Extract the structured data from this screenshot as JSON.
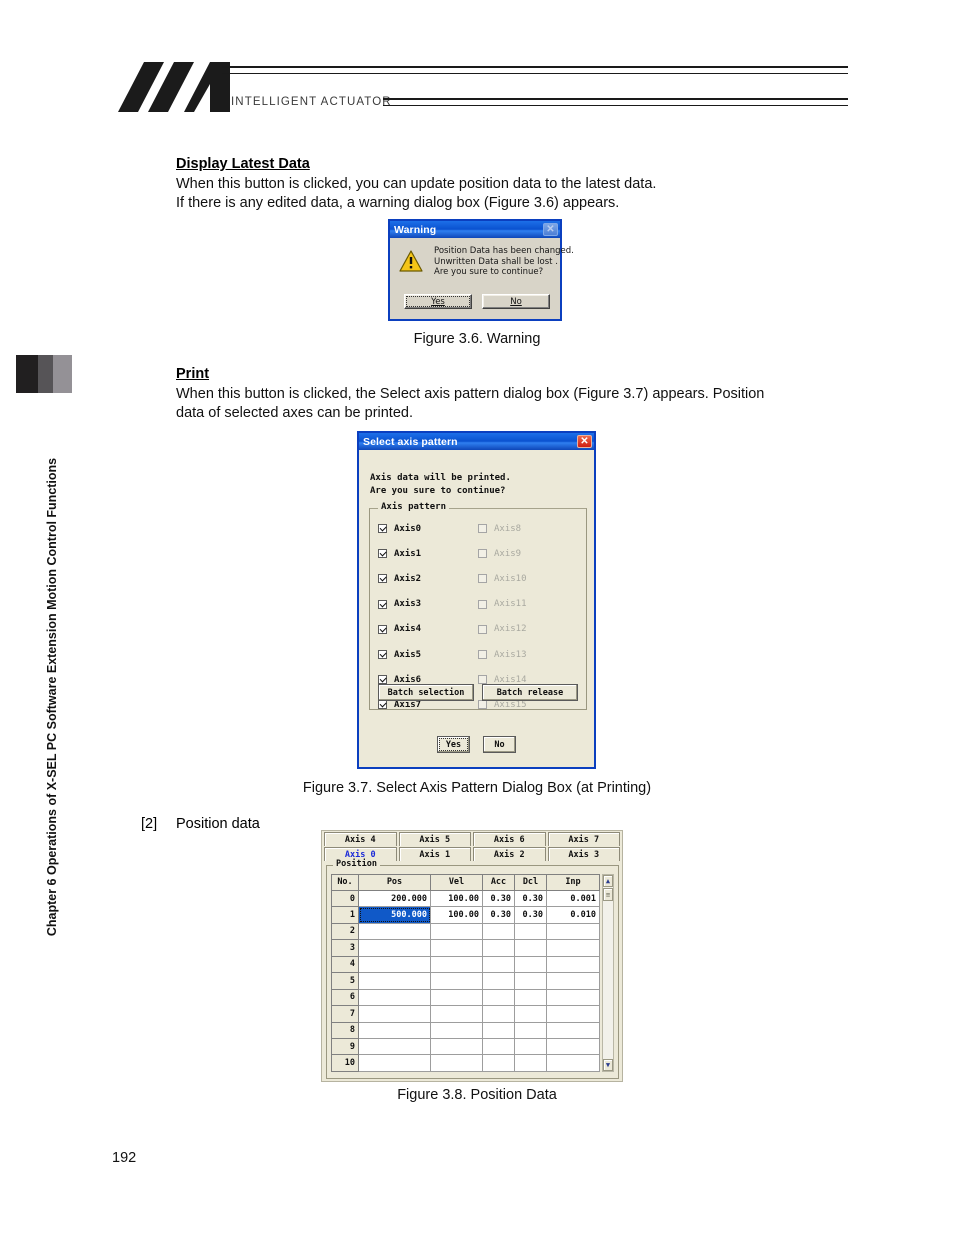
{
  "header": {
    "brand": "INTELLIGENT ACTUATOR",
    "logo_icon": "ia-logo-icon"
  },
  "sidebar": {
    "chapter_title": "Chapter 6 Operations of X-SEL PC Software Extension Motion Control Functions"
  },
  "sections": [
    {
      "heading": "Display Latest Data",
      "body_line1": "When this button is clicked, you can update position data to the latest data.",
      "body_line2": "If there is any edited data, a warning dialog box (Figure 3.6) appears."
    },
    {
      "heading": "Print",
      "body_line1": "When this button is clicked, the Select axis pattern dialog box (Figure 3.7) appears. Position",
      "body_line2": "data of selected axes can be printed."
    }
  ],
  "captions": {
    "fig36": "Figure 3.6. Warning",
    "fig37": "Figure 3.7. Select Axis Pattern Dialog Box (at Printing)",
    "fig38": "Figure 3.8. Position Data"
  },
  "list_item": {
    "marker": "[2]",
    "text": "Position data"
  },
  "page_number": "192",
  "warning_dialog": {
    "title": "Warning",
    "close_icon": "close-icon",
    "warning_icon": "warning-triangle-icon",
    "message_line1": "Position Data has been changed.",
    "message_line2": "Unwritten Data shall be lost .",
    "message_line3": "Are you sure to continue?",
    "yes_label": "Yes",
    "no_label": "No"
  },
  "axis_dialog": {
    "title": "Select axis pattern",
    "close_icon": "close-icon",
    "intro_line1": "Axis data will be printed.",
    "intro_line2": "Are you sure to continue?",
    "group_label": "Axis pattern",
    "checkbox_rows": [
      {
        "left": {
          "label": "Axis0",
          "checked": true,
          "enabled": true
        },
        "right": {
          "label": "Axis8",
          "checked": false,
          "enabled": false
        }
      },
      {
        "left": {
          "label": "Axis1",
          "checked": true,
          "enabled": true
        },
        "right": {
          "label": "Axis9",
          "checked": false,
          "enabled": false
        }
      },
      {
        "left": {
          "label": "Axis2",
          "checked": true,
          "enabled": true
        },
        "right": {
          "label": "Axis10",
          "checked": false,
          "enabled": false
        }
      },
      {
        "left": {
          "label": "Axis3",
          "checked": true,
          "enabled": true
        },
        "right": {
          "label": "Axis11",
          "checked": false,
          "enabled": false
        }
      },
      {
        "left": {
          "label": "Axis4",
          "checked": true,
          "enabled": true
        },
        "right": {
          "label": "Axis12",
          "checked": false,
          "enabled": false
        }
      },
      {
        "left": {
          "label": "Axis5",
          "checked": true,
          "enabled": true
        },
        "right": {
          "label": "Axis13",
          "checked": false,
          "enabled": false
        }
      },
      {
        "left": {
          "label": "Axis6",
          "checked": true,
          "enabled": true
        },
        "right": {
          "label": "Axis14",
          "checked": false,
          "enabled": false
        }
      },
      {
        "left": {
          "label": "Axis7",
          "checked": true,
          "enabled": true
        },
        "right": {
          "label": "Axis15",
          "checked": false,
          "enabled": false
        }
      }
    ],
    "batch_selection_label": "Batch selection",
    "batch_release_label": "Batch release",
    "yes_label": "Yes",
    "no_label": "No"
  },
  "position_window": {
    "tabs_top": [
      "Axis 4",
      "Axis 5",
      "Axis 6",
      "Axis 7"
    ],
    "tabs_bottom": [
      "Axis 0",
      "Axis 1",
      "Axis 2",
      "Axis 3"
    ],
    "active_tab": "Axis 0",
    "group_label": "Position",
    "columns": [
      "No.",
      "Pos",
      "Vel",
      "Acc",
      "Dcl",
      "Inp"
    ],
    "rows": [
      {
        "no": "0",
        "pos": "200.000",
        "vel": "100.00",
        "acc": "0.30",
        "dcl": "0.30",
        "inp": "0.001",
        "selected": false
      },
      {
        "no": "1",
        "pos": "500.000",
        "vel": "100.00",
        "acc": "0.30",
        "dcl": "0.30",
        "inp": "0.010",
        "selected": true
      },
      {
        "no": "2",
        "pos": "",
        "vel": "",
        "acc": "",
        "dcl": "",
        "inp": "",
        "selected": false
      },
      {
        "no": "3",
        "pos": "",
        "vel": "",
        "acc": "",
        "dcl": "",
        "inp": "",
        "selected": false
      },
      {
        "no": "4",
        "pos": "",
        "vel": "",
        "acc": "",
        "dcl": "",
        "inp": "",
        "selected": false
      },
      {
        "no": "5",
        "pos": "",
        "vel": "",
        "acc": "",
        "dcl": "",
        "inp": "",
        "selected": false
      },
      {
        "no": "6",
        "pos": "",
        "vel": "",
        "acc": "",
        "dcl": "",
        "inp": "",
        "selected": false
      },
      {
        "no": "7",
        "pos": "",
        "vel": "",
        "acc": "",
        "dcl": "",
        "inp": "",
        "selected": false
      },
      {
        "no": "8",
        "pos": "",
        "vel": "",
        "acc": "",
        "dcl": "",
        "inp": "",
        "selected": false
      },
      {
        "no": "9",
        "pos": "",
        "vel": "",
        "acc": "",
        "dcl": "",
        "inp": "",
        "selected": false
      },
      {
        "no": "10",
        "pos": "",
        "vel": "",
        "acc": "",
        "dcl": "",
        "inp": "",
        "selected": false
      }
    ],
    "scroll_up_icon": "chevron-up-icon",
    "scroll_down_icon": "chevron-down-icon"
  },
  "colors": {
    "titlebar_blue": "#0b52d0",
    "dialog_face": "#ece9d8",
    "selection_blue": "#1059c8",
    "active_tab_text": "#1b2ad8",
    "close_red": "#cf1d10"
  }
}
